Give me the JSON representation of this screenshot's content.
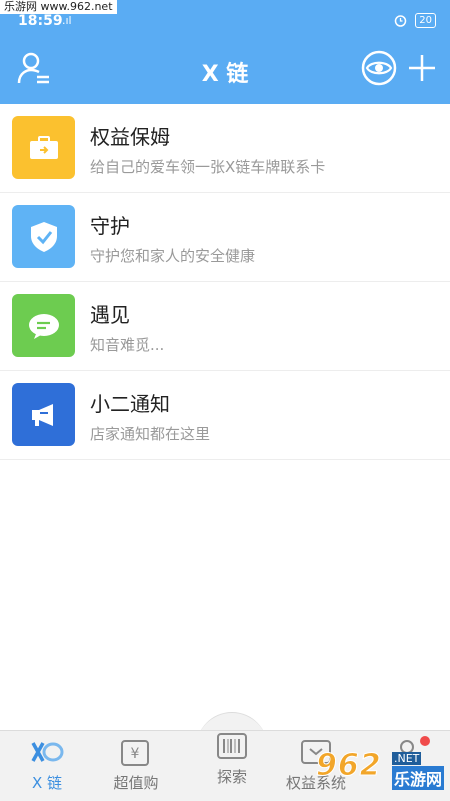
{
  "status_bar": {
    "time": "18:59",
    "signal": ".ıl",
    "battery": "20"
  },
  "watermark": {
    "top_text": "乐游网 www.962.net",
    "bottom_number": "962",
    "bottom_net": ".NET",
    "bottom_cn": "乐游网"
  },
  "header": {
    "title": "X 链"
  },
  "list": [
    {
      "title": "权益保姆",
      "subtitle": "给自己的爱车领一张X链车牌联系卡",
      "color": "#fbc12f",
      "icon": "briefcase-icon"
    },
    {
      "title": "守护",
      "subtitle": "守护您和家人的安全健康",
      "color": "#5fb3f5",
      "icon": "shield-icon"
    },
    {
      "title": "遇见",
      "subtitle": "知音难觅...",
      "color": "#6dcc50",
      "icon": "chat-bubble-icon"
    },
    {
      "title": "小二通知",
      "subtitle": "店家通知都在这里",
      "color": "#2f6fd8",
      "icon": "megaphone-icon"
    }
  ],
  "bottom_nav": [
    {
      "label": "X 链",
      "icon": "x-chain-logo-icon",
      "active": true
    },
    {
      "label": "超值购",
      "icon": "price-tag-icon",
      "active": false
    },
    {
      "label": "探索",
      "icon": "barcode-icon",
      "active": false
    },
    {
      "label": "权益系统",
      "icon": "shield-card-icon",
      "active": false
    },
    {
      "label": "",
      "icon": "profile-icon",
      "active": false
    }
  ],
  "colors": {
    "header_bg": "#5aacf3",
    "nav_active": "#3c8fe0"
  }
}
